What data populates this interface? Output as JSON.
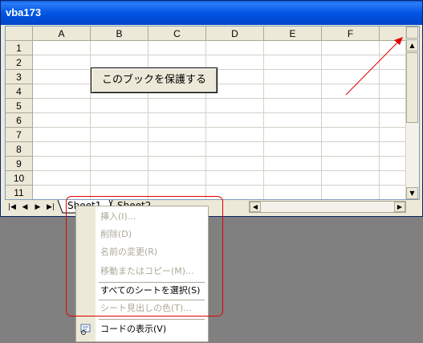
{
  "window": {
    "title": "vba173"
  },
  "grid": {
    "columns": [
      "A",
      "B",
      "C",
      "D",
      "E",
      "F"
    ],
    "rows": [
      "1",
      "2",
      "3",
      "4",
      "5",
      "6",
      "7",
      "8",
      "9",
      "10",
      "11"
    ]
  },
  "sheet_button": {
    "label": "このブックを保護する"
  },
  "tabs": [
    "Sheet1",
    "Sheet2"
  ],
  "nav": [
    "first-icon",
    "prev-icon",
    "next-icon",
    "last-icon"
  ],
  "context_menu": {
    "items": [
      {
        "label": "挿入(I)...",
        "enabled": false
      },
      {
        "label": "削除(D)",
        "enabled": false
      },
      {
        "label": "名前の変更(R)",
        "enabled": false
      },
      {
        "label": "移動またはコピー(M)...",
        "enabled": false
      },
      {
        "label": "すべてのシートを選択(S)",
        "enabled": true
      },
      {
        "label": "シート見出しの色(T)...",
        "enabled": false
      },
      {
        "label": "コードの表示(V)",
        "enabled": true
      }
    ]
  },
  "colors": {
    "annotation": "#E00000",
    "titlebar": "#0055E5"
  }
}
